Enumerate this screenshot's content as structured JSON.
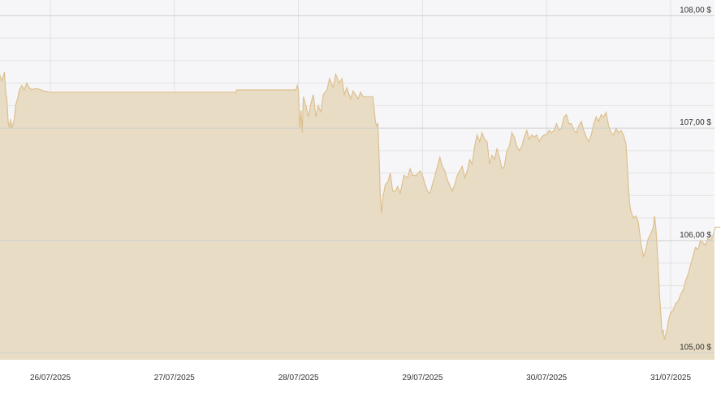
{
  "chart_data": {
    "type": "area",
    "currency": "$",
    "x_ticks": [
      "26/07/2025",
      "27/07/2025",
      "28/07/2025",
      "29/07/2025",
      "30/07/2025",
      "31/07/2025"
    ],
    "y_ticks": [
      {
        "value": 108.0,
        "label": "108,00 $"
      },
      {
        "value": 107.0,
        "label": "107,00 $"
      },
      {
        "value": 106.0,
        "label": "106,00 $"
      },
      {
        "value": 105.0,
        "label": "105,00 $"
      }
    ],
    "ylim": [
      104.94,
      108.14
    ],
    "xlim": [
      0,
      5.74
    ],
    "grid": true,
    "colors": {
      "background": "#f6f6f8",
      "fill": "#e9dcc4",
      "line": "#dcc08f",
      "major_grid": "#cfcfcf",
      "minor_grid": "#e2e2e2"
    },
    "series": [
      {
        "points": [
          [
            -0.41,
            107.48
          ],
          [
            -0.39,
            107.42
          ],
          [
            -0.37,
            107.5
          ],
          [
            -0.36,
            107.32
          ],
          [
            -0.35,
            107.26
          ],
          [
            -0.34,
            107.06
          ],
          [
            -0.33,
            107.0
          ],
          [
            -0.32,
            107.08
          ],
          [
            -0.31,
            107.0
          ],
          [
            -0.29,
            107.08
          ],
          [
            -0.28,
            107.2
          ],
          [
            -0.26,
            107.28
          ],
          [
            -0.25,
            107.34
          ],
          [
            -0.23,
            107.38
          ],
          [
            -0.21,
            107.34
          ],
          [
            -0.19,
            107.4
          ],
          [
            -0.17,
            107.36
          ],
          [
            -0.15,
            107.34
          ],
          [
            -0.13,
            107.35
          ],
          [
            -0.1,
            107.35
          ],
          [
            -0.05,
            107.33
          ],
          [
            0.0,
            107.32
          ],
          [
            0.5,
            107.32
          ],
          [
            1.0,
            107.32
          ],
          [
            1.5,
            107.32
          ],
          [
            1.5,
            107.34
          ],
          [
            1.8,
            107.34
          ],
          [
            1.98,
            107.34
          ],
          [
            1.99,
            107.38
          ],
          [
            2.0,
            107.34
          ],
          [
            2.01,
            107.0
          ],
          [
            2.02,
            107.16
          ],
          [
            2.03,
            106.96
          ],
          [
            2.04,
            107.28
          ],
          [
            2.06,
            107.2
          ],
          [
            2.08,
            107.1
          ],
          [
            2.1,
            107.22
          ],
          [
            2.12,
            107.3
          ],
          [
            2.14,
            107.1
          ],
          [
            2.16,
            107.2
          ],
          [
            2.18,
            107.14
          ],
          [
            2.2,
            107.3
          ],
          [
            2.23,
            107.34
          ],
          [
            2.25,
            107.44
          ],
          [
            2.28,
            107.36
          ],
          [
            2.3,
            107.48
          ],
          [
            2.33,
            107.4
          ],
          [
            2.35,
            107.44
          ],
          [
            2.37,
            107.3
          ],
          [
            2.39,
            107.36
          ],
          [
            2.42,
            107.26
          ],
          [
            2.44,
            107.33
          ],
          [
            2.46,
            107.3
          ],
          [
            2.48,
            107.26
          ],
          [
            2.5,
            107.32
          ],
          [
            2.52,
            107.28
          ],
          [
            2.6,
            107.28
          ],
          [
            2.62,
            107.06
          ],
          [
            2.63,
            107.02
          ],
          [
            2.64,
            107.04
          ],
          [
            2.65,
            106.76
          ],
          [
            2.66,
            106.4
          ],
          [
            2.67,
            106.24
          ],
          [
            2.68,
            106.38
          ],
          [
            2.7,
            106.5
          ],
          [
            2.72,
            106.52
          ],
          [
            2.74,
            106.6
          ],
          [
            2.76,
            106.44
          ],
          [
            2.78,
            106.44
          ],
          [
            2.8,
            106.48
          ],
          [
            2.82,
            106.42
          ],
          [
            2.85,
            106.58
          ],
          [
            2.88,
            106.56
          ],
          [
            2.9,
            106.64
          ],
          [
            2.92,
            106.58
          ],
          [
            2.95,
            106.58
          ],
          [
            2.98,
            106.62
          ],
          [
            3.0,
            106.58
          ],
          [
            3.02,
            106.5
          ],
          [
            3.04,
            106.44
          ],
          [
            3.06,
            106.42
          ],
          [
            3.08,
            106.5
          ],
          [
            3.1,
            106.58
          ],
          [
            3.14,
            106.74
          ],
          [
            3.16,
            106.66
          ],
          [
            3.18,
            106.62
          ],
          [
            3.2,
            106.54
          ],
          [
            3.24,
            106.44
          ],
          [
            3.26,
            106.5
          ],
          [
            3.28,
            106.58
          ],
          [
            3.3,
            106.62
          ],
          [
            3.32,
            106.66
          ],
          [
            3.34,
            106.56
          ],
          [
            3.36,
            106.62
          ],
          [
            3.38,
            106.72
          ],
          [
            3.4,
            106.68
          ],
          [
            3.42,
            106.84
          ],
          [
            3.44,
            106.94
          ],
          [
            3.46,
            106.88
          ],
          [
            3.48,
            106.96
          ],
          [
            3.5,
            106.9
          ],
          [
            3.52,
            106.88
          ],
          [
            3.54,
            106.68
          ],
          [
            3.56,
            106.76
          ],
          [
            3.58,
            106.72
          ],
          [
            3.6,
            106.82
          ],
          [
            3.62,
            106.74
          ],
          [
            3.64,
            106.64
          ],
          [
            3.66,
            106.66
          ],
          [
            3.68,
            106.8
          ],
          [
            3.7,
            106.84
          ],
          [
            3.72,
            106.96
          ],
          [
            3.74,
            106.92
          ],
          [
            3.76,
            106.84
          ],
          [
            3.78,
            106.8
          ],
          [
            3.8,
            106.84
          ],
          [
            3.82,
            106.92
          ],
          [
            3.84,
            106.98
          ],
          [
            3.86,
            106.9
          ],
          [
            3.88,
            106.94
          ],
          [
            3.9,
            106.92
          ],
          [
            3.92,
            106.94
          ],
          [
            3.94,
            106.88
          ],
          [
            3.96,
            106.92
          ],
          [
            3.98,
            106.94
          ],
          [
            4.0,
            106.94
          ],
          [
            4.02,
            106.98
          ],
          [
            4.04,
            106.96
          ],
          [
            4.06,
            106.98
          ],
          [
            4.08,
            107.04
          ],
          [
            4.1,
            106.98
          ],
          [
            4.12,
            107.0
          ],
          [
            4.14,
            107.1
          ],
          [
            4.16,
            107.12
          ],
          [
            4.18,
            107.04
          ],
          [
            4.2,
            107.04
          ],
          [
            4.22,
            106.98
          ],
          [
            4.24,
            106.96
          ],
          [
            4.26,
            107.02
          ],
          [
            4.28,
            107.06
          ],
          [
            4.3,
            106.98
          ],
          [
            4.32,
            106.92
          ],
          [
            4.34,
            106.88
          ],
          [
            4.36,
            106.94
          ],
          [
            4.38,
            107.04
          ],
          [
            4.4,
            107.1
          ],
          [
            4.42,
            107.06
          ],
          [
            4.44,
            107.12
          ],
          [
            4.46,
            107.1
          ],
          [
            4.48,
            107.14
          ],
          [
            4.5,
            107.02
          ],
          [
            4.52,
            106.96
          ],
          [
            4.54,
            106.94
          ],
          [
            4.56,
            107.0
          ],
          [
            4.58,
            106.96
          ],
          [
            4.6,
            106.98
          ],
          [
            4.62,
            106.94
          ],
          [
            4.63,
            106.9
          ],
          [
            4.64,
            106.86
          ],
          [
            4.65,
            106.68
          ],
          [
            4.66,
            106.48
          ],
          [
            4.67,
            106.32
          ],
          [
            4.68,
            106.26
          ],
          [
            4.7,
            106.2
          ],
          [
            4.72,
            106.22
          ],
          [
            4.74,
            106.16
          ],
          [
            4.76,
            105.98
          ],
          [
            4.78,
            105.86
          ],
          [
            4.8,
            105.92
          ],
          [
            4.82,
            106.02
          ],
          [
            4.84,
            106.06
          ],
          [
            4.86,
            106.12
          ],
          [
            4.87,
            106.22
          ],
          [
            4.88,
            106.12
          ],
          [
            4.89,
            105.96
          ],
          [
            4.9,
            105.76
          ],
          [
            4.91,
            105.52
          ],
          [
            4.92,
            105.36
          ],
          [
            4.93,
            105.18
          ],
          [
            4.94,
            105.2
          ],
          [
            4.95,
            105.12
          ],
          [
            4.96,
            105.16
          ],
          [
            4.97,
            105.2
          ],
          [
            4.98,
            105.28
          ],
          [
            5.0,
            105.36
          ],
          [
            5.02,
            105.38
          ],
          [
            5.04,
            105.44
          ],
          [
            5.06,
            105.46
          ],
          [
            5.08,
            105.52
          ],
          [
            5.1,
            105.56
          ],
          [
            5.12,
            105.64
          ],
          [
            5.14,
            105.7
          ],
          [
            5.16,
            105.78
          ],
          [
            5.18,
            105.86
          ],
          [
            5.2,
            105.94
          ],
          [
            5.22,
            105.92
          ],
          [
            5.24,
            106.0
          ],
          [
            5.26,
            105.98
          ],
          [
            5.28,
            105.96
          ],
          [
            5.3,
            106.02
          ],
          [
            5.32,
            106.0
          ],
          [
            5.34,
            106.04
          ],
          [
            5.36,
            106.12
          ],
          [
            5.38,
            106.12
          ],
          [
            5.4,
            106.12
          ]
        ]
      }
    ]
  }
}
